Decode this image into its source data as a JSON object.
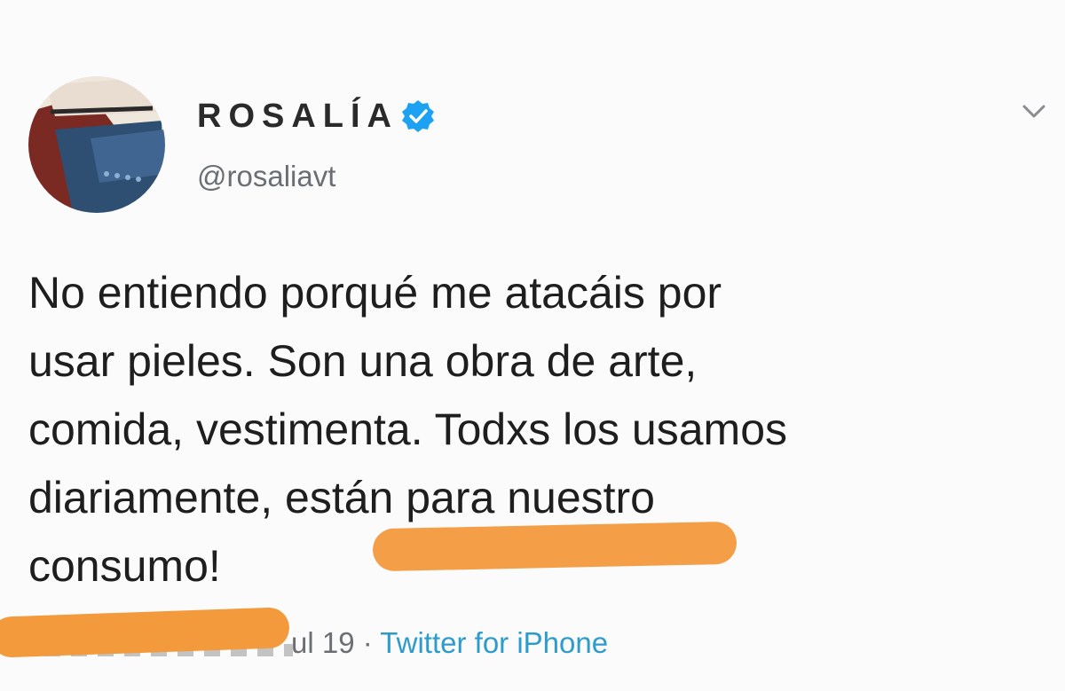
{
  "user": {
    "display_name": "ROSALÍA",
    "handle": "@rosaliavt",
    "verified": true,
    "verified_icon": "verified-badge-icon",
    "verified_color": "#1da1f2"
  },
  "tweet": {
    "lines": [
      "No entiendo porqué me atacáis por",
      "usar pieles. Son una obra de arte,",
      "comida, vestimenta. Todxs los usamos",
      "diariamente, están para nuestro",
      "consumo!"
    ]
  },
  "meta": {
    "date_visible": "ul 19",
    "separator": "·",
    "source": "Twitter for iPhone",
    "source_color": "#2d9ccc"
  },
  "icons": {
    "menu": "chevron-down-icon",
    "avatar": "avatar-image"
  },
  "colors": {
    "highlight": "#f39a3d",
    "background": "#fbfbfb",
    "secondary_text": "#6b6f73"
  }
}
